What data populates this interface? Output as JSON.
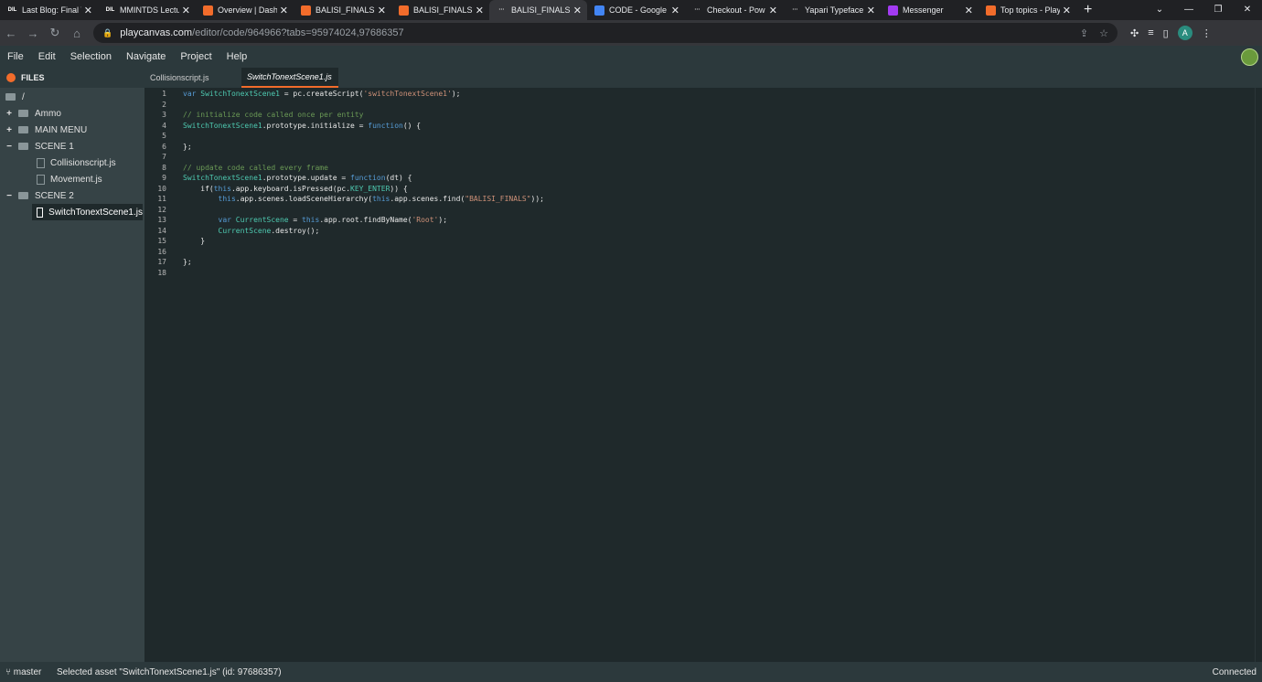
{
  "browser": {
    "tabs": [
      {
        "icon": "dil-favicon-icon",
        "fav_text": "DIL",
        "fav_bg": "#202124",
        "title": "Last Blog: Final V"
      },
      {
        "icon": "dil-favicon-icon",
        "fav_text": "DIL",
        "fav_bg": "#202124",
        "title": "MMINTDS Lectu"
      },
      {
        "icon": "playcanvas-favicon-icon",
        "fav_text": "",
        "fav_bg": "#f26c2b",
        "title": "Overview | Dash"
      },
      {
        "icon": "playcanvas-favicon-icon",
        "fav_text": "",
        "fav_bg": "#f26c2b",
        "title": "BALISI_FINALS |"
      },
      {
        "icon": "playcanvas-favicon-icon",
        "fav_text": "",
        "fav_bg": "#f26c2b",
        "title": "BALISI_FINALS |"
      },
      {
        "icon": "loading-favicon-icon",
        "fav_text": "···",
        "fav_bg": "#35363a",
        "title": "BALISI_FINALS |",
        "active": true
      },
      {
        "icon": "google-docs-favicon-icon",
        "fav_text": "",
        "fav_bg": "#4285f4",
        "title": "CODE - Google"
      },
      {
        "icon": "loading-favicon-icon",
        "fav_text": "···",
        "fav_bg": "#202124",
        "title": "Checkout - Pow"
      },
      {
        "icon": "loading-favicon-icon",
        "fav_text": "···",
        "fav_bg": "#202124",
        "title": "Yapari Typeface"
      },
      {
        "icon": "messenger-favicon-icon",
        "fav_text": "",
        "fav_bg": "#a33bf2",
        "title": "Messenger"
      },
      {
        "icon": "playcanvas-favicon-icon",
        "fav_text": "",
        "fav_bg": "#f26c2b",
        "title": "Top topics - Play"
      }
    ],
    "url_host": "playcanvas.com",
    "url_path": "/editor/code/964966?tabs=95974024,97686357",
    "profile_initial": "A"
  },
  "menu": [
    "File",
    "Edit",
    "Selection",
    "Navigate",
    "Project",
    "Help"
  ],
  "files_panel": {
    "header": "FILES",
    "tree": [
      {
        "kind": "root",
        "label": "/"
      },
      {
        "kind": "folder",
        "toggle": "+",
        "label": "Ammo"
      },
      {
        "kind": "folder",
        "toggle": "+",
        "label": "MAIN MENU"
      },
      {
        "kind": "folder",
        "toggle": "−",
        "label": "SCENE 1"
      },
      {
        "kind": "file",
        "label": "Collisionscript.js"
      },
      {
        "kind": "file",
        "label": "Movement.js"
      },
      {
        "kind": "folder",
        "toggle": "−",
        "label": "SCENE 2"
      },
      {
        "kind": "file",
        "label": "SwitchTonextScene1.js",
        "selected": true
      }
    ]
  },
  "editor": {
    "tabs": [
      {
        "label": "Collisionscript.js",
        "active": false
      },
      {
        "label": "SwitchTonextScene1.js",
        "active": true
      }
    ],
    "lines": [
      {
        "n": "1",
        "t": [
          [
            "k",
            "var "
          ],
          [
            "v",
            "SwitchTonextScene1"
          ],
          [
            "p",
            " = pc.createScript("
          ],
          [
            "s",
            "'switchTonextScene1'"
          ],
          [
            "p",
            ");"
          ]
        ]
      },
      {
        "n": "2",
        "t": []
      },
      {
        "n": "3",
        "t": [
          [
            "c",
            "// initialize code called once per entity"
          ]
        ]
      },
      {
        "n": "4",
        "t": [
          [
            "v",
            "SwitchTonextScene1"
          ],
          [
            "p",
            ".prototype.initialize = "
          ],
          [
            "k",
            "function"
          ],
          [
            "p",
            "() {"
          ]
        ]
      },
      {
        "n": "5",
        "t": []
      },
      {
        "n": "6",
        "t": [
          [
            "p",
            "};"
          ]
        ]
      },
      {
        "n": "7",
        "t": []
      },
      {
        "n": "8",
        "t": [
          [
            "c",
            "// update code called every frame"
          ]
        ]
      },
      {
        "n": "9",
        "t": [
          [
            "v",
            "SwitchTonextScene1"
          ],
          [
            "p",
            ".prototype.update = "
          ],
          [
            "k",
            "function"
          ],
          [
            "p",
            "(dt) {"
          ]
        ]
      },
      {
        "n": "10",
        "t": [
          [
            "p",
            "    if("
          ],
          [
            "k",
            "this"
          ],
          [
            "p",
            ".app.keyboard.isPressed(pc."
          ],
          [
            "v",
            "KEY_ENTER"
          ],
          [
            "p",
            ")) {"
          ]
        ]
      },
      {
        "n": "11",
        "t": [
          [
            "p",
            "        "
          ],
          [
            "k",
            "this"
          ],
          [
            "p",
            ".app.scenes.loadSceneHierarchy("
          ],
          [
            "k",
            "this"
          ],
          [
            "p",
            ".app.scenes.find("
          ],
          [
            "s",
            "\"BALISI_FINALS\""
          ],
          [
            "p",
            "));"
          ]
        ]
      },
      {
        "n": "12",
        "t": []
      },
      {
        "n": "13",
        "t": [
          [
            "p",
            "        "
          ],
          [
            "k",
            "var "
          ],
          [
            "v",
            "CurrentScene"
          ],
          [
            "p",
            " = "
          ],
          [
            "k",
            "this"
          ],
          [
            "p",
            ".app.root.findByName("
          ],
          [
            "s",
            "'Root'"
          ],
          [
            "p",
            ");"
          ]
        ]
      },
      {
        "n": "14",
        "t": [
          [
            "p",
            "        "
          ],
          [
            "v",
            "CurrentScene"
          ],
          [
            "p",
            ".destroy();"
          ]
        ]
      },
      {
        "n": "15",
        "t": [
          [
            "p",
            "    }"
          ]
        ]
      },
      {
        "n": "16",
        "t": []
      },
      {
        "n": "17",
        "t": [
          [
            "p",
            "};"
          ]
        ]
      },
      {
        "n": "18",
        "t": []
      }
    ]
  },
  "status": {
    "branch": "master",
    "message": "Selected asset \"SwitchTonextScene1.js\" (id: 97686357)",
    "connection": "Connected"
  }
}
